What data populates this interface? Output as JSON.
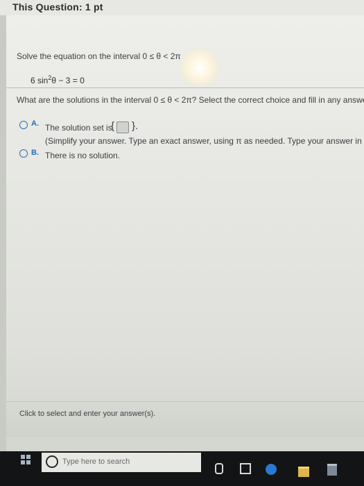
{
  "header": {
    "title": "This Question:",
    "points": "1 pt"
  },
  "question": {
    "prompt": "Solve the equation on the interval 0 ≤ θ < 2π",
    "equation_pre": "6 sin",
    "equation_sup": "2",
    "equation_post": "θ − 3 = 0",
    "sub_question": "What are the solutions in the interval 0 ≤ θ < 2π? Select the correct choice and fill in any answer"
  },
  "choices": {
    "a_letter": "A.",
    "a_text": "The solution set is",
    "a_brace_open": "{",
    "a_brace_close": "}.",
    "a_hint": "(Simplify your answer. Type an exact answer, using π as needed. Type your answer in ra",
    "b_letter": "B.",
    "b_text": "There is no solution."
  },
  "footer": {
    "instruction": "Click to select and enter your answer(s)."
  },
  "taskbar": {
    "search_placeholder": "Type here to search"
  },
  "icons": {
    "windows": "windows-icon",
    "mic": "microphone-icon",
    "task_view": "task-view-icon",
    "edge": "edge-browser-icon",
    "folder": "file-explorer-icon",
    "store": "store-icon"
  }
}
